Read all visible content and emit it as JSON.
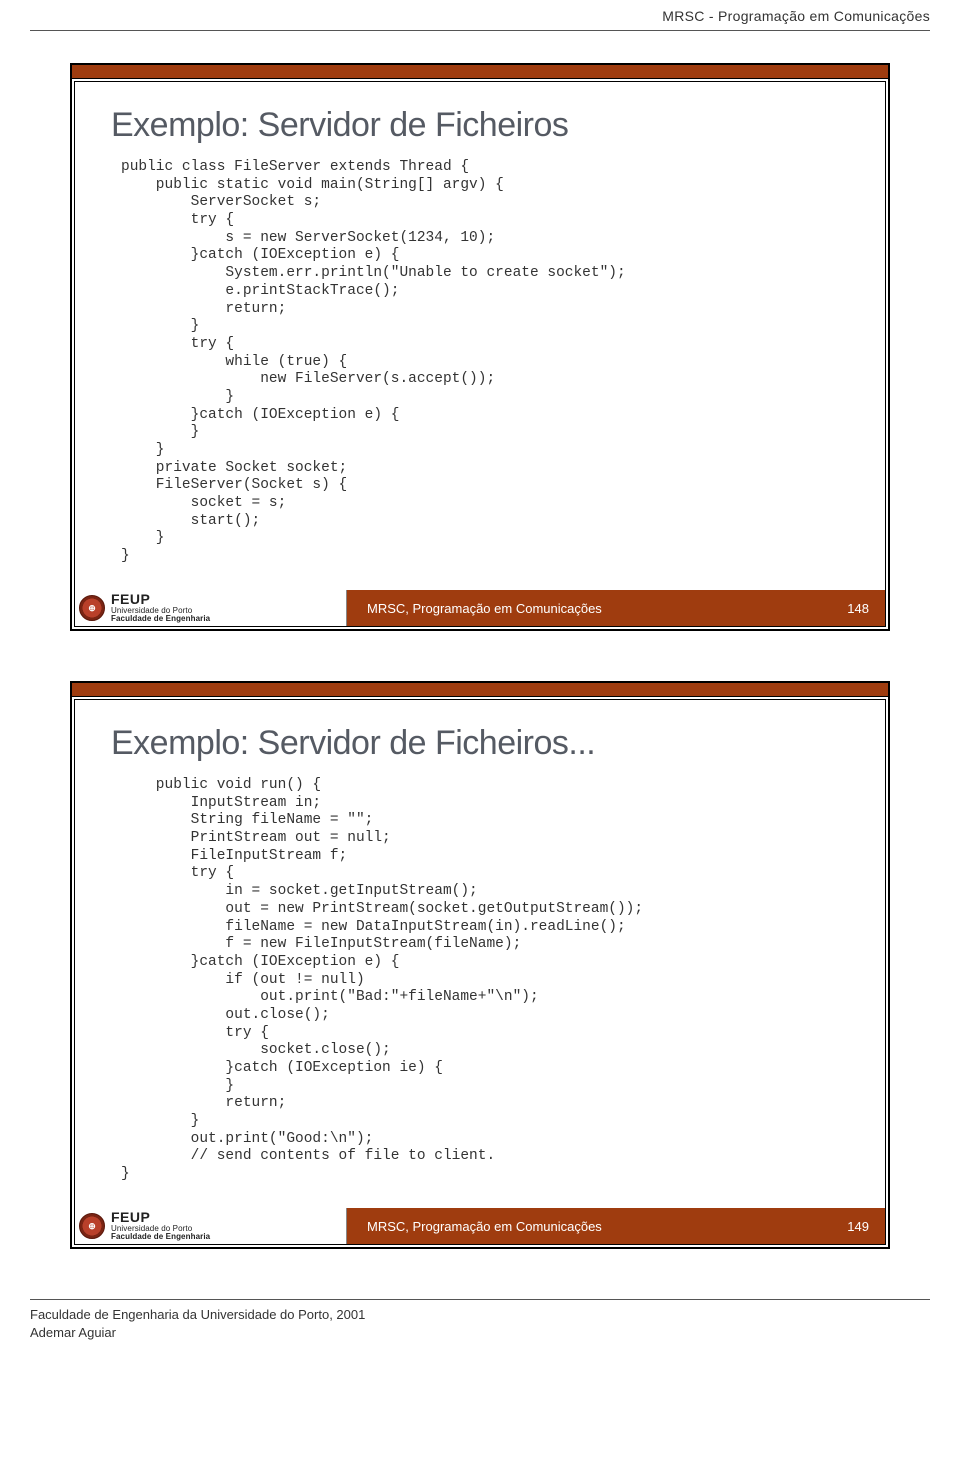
{
  "doc_header": "MRSC - Programação em Comunicações",
  "slide1": {
    "title": "Exemplo: Servidor de Ficheiros",
    "code": "public class FileServer extends Thread {\n    public static void main(String[] argv) {\n        ServerSocket s;\n        try {\n            s = new ServerSocket(1234, 10);\n        }catch (IOException e) {\n            System.err.println(\"Unable to create socket\");\n            e.printStackTrace();\n            return;\n        }\n        try {\n            while (true) {\n                new FileServer(s.accept());\n            }\n        }catch (IOException e) {\n        }\n    }\n    private Socket socket;\n    FileServer(Socket s) {\n        socket = s;\n        start();\n    }\n}",
    "footer_text": "MRSC, Programação em Comunicações",
    "page_no": "148"
  },
  "slide2": {
    "title": "Exemplo: Servidor de Ficheiros...",
    "code": "    public void run() {\n        InputStream in;\n        String fileName = \"\";\n        PrintStream out = null;\n        FileInputStream f;\n        try {\n            in = socket.getInputStream();\n            out = new PrintStream(socket.getOutputStream());\n            fileName = new DataInputStream(in).readLine();\n            f = new FileInputStream(fileName);\n        }catch (IOException e) {\n            if (out != null)\n                out.print(\"Bad:\"+fileName+\"\\n\");\n            out.close();\n            try {\n                socket.close();\n            }catch (IOException ie) {\n            }\n            return;\n        }\n        out.print(\"Good:\\n\");\n        // send contents of file to client.\n}",
    "footer_text": "MRSC, Programação em Comunicações",
    "page_no": "149"
  },
  "feup": {
    "name": "FEUP",
    "line1": "Universidade do Porto",
    "line2": "Faculdade de Engenharia"
  },
  "page_footer": {
    "line1": "Faculdade de Engenharia da Universidade do Porto, 2001",
    "line2": "Ademar Aguiar"
  }
}
